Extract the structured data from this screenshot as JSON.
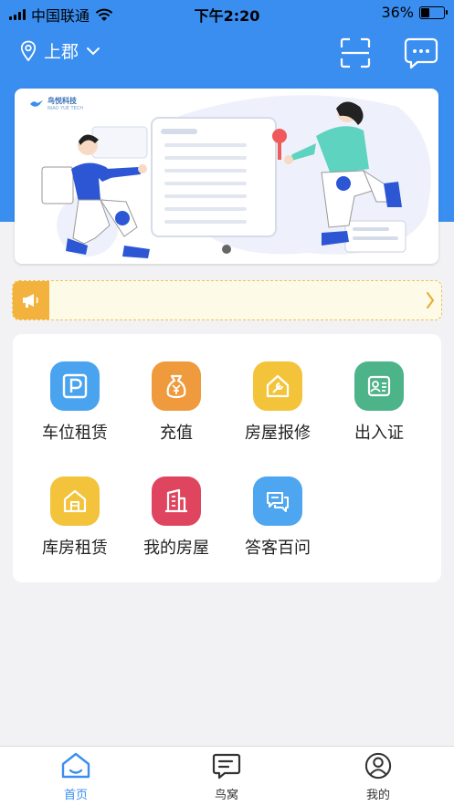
{
  "status_bar": {
    "carrier": "中国联通",
    "time": "下午2:20",
    "battery_percent": "36%",
    "battery_level": 0.36
  },
  "header": {
    "location": "上郡",
    "icons": [
      "location-pin-icon",
      "chevron-down-icon",
      "scan-icon",
      "message-icon"
    ]
  },
  "banner": {
    "logo_text": "鸟悦科技",
    "logo_subtext": "NIAO YUE TECH"
  },
  "notice": {
    "text": "",
    "icons": [
      "megaphone-icon",
      "chevron-right-icon"
    ]
  },
  "menu": {
    "items": [
      {
        "label": "车位租赁",
        "icon": "parking-icon",
        "color": "#4aa3ef"
      },
      {
        "label": "充值",
        "icon": "money-bag-icon",
        "color": "#ef9a3c"
      },
      {
        "label": "房屋报修",
        "icon": "house-repair-icon",
        "color": "#f3c43a"
      },
      {
        "label": "出入证",
        "icon": "id-card-icon",
        "color": "#4db388"
      },
      {
        "label": "库房租赁",
        "icon": "warehouse-icon",
        "color": "#f2c33b"
      },
      {
        "label": "我的房屋",
        "icon": "building-icon",
        "color": "#e0455f"
      },
      {
        "label": "答客百问",
        "icon": "chat-bubbles-icon",
        "color": "#4da6ef"
      }
    ]
  },
  "tabbar": {
    "tabs": [
      {
        "label": "首页",
        "icon": "home-icon",
        "active": true
      },
      {
        "label": "鸟窝",
        "icon": "chat-icon",
        "active": false
      },
      {
        "label": "我的",
        "icon": "user-icon",
        "active": false
      }
    ],
    "accent_color": "#3a8ef0"
  },
  "colors": {
    "brand_blue": "#3a8ef0",
    "notice_yellow": "#f3b23d"
  }
}
